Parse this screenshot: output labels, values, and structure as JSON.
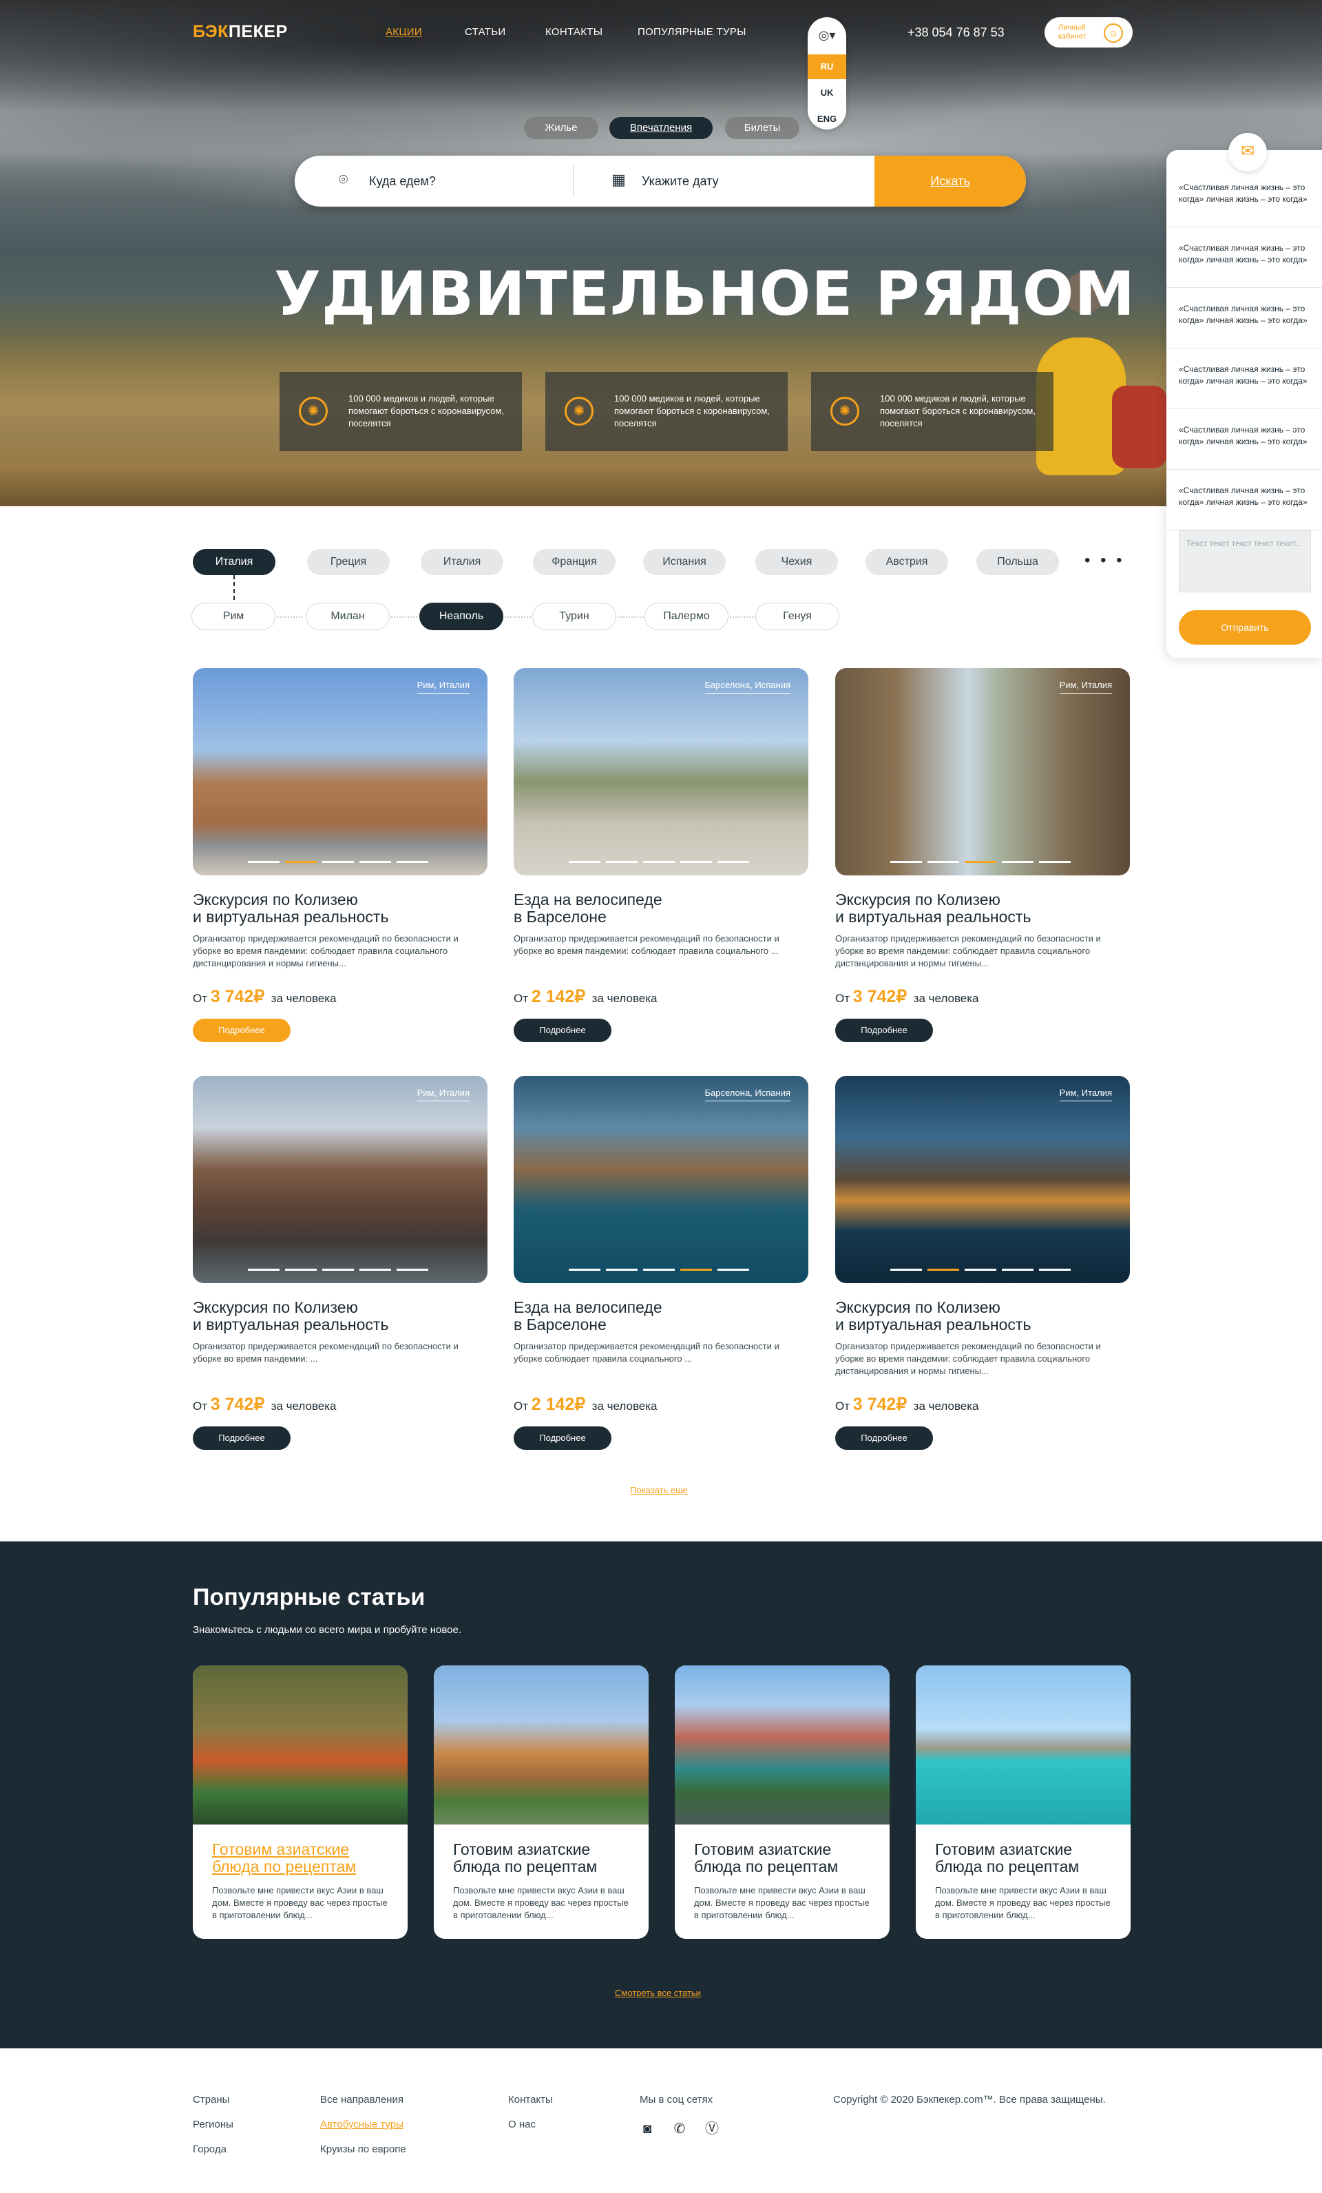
{
  "header": {
    "logo": "БЭКПЕКЕР",
    "nav": [
      "АКЦИИ",
      "СТАТЬИ",
      "КОНТАКТЫ",
      "ПОПУЛЯРНЫЕ ТУРЫ"
    ],
    "languages": [
      "RU",
      "UK",
      "ENG"
    ],
    "selected_language": "RU",
    "phone": "+38 054 76 87 53",
    "cabinet": "Личный кабинет"
  },
  "tabs": [
    "Жилье",
    "Впечатления",
    "Билеты"
  ],
  "search": {
    "where_placeholder": "Куда едем?",
    "date_placeholder": "Укажите дату",
    "button": "Искать"
  },
  "hero": {
    "title": "УДИВИТЕЛЬНОЕ РЯДОМ",
    "features": [
      "100 000 медиков и людей, которые помогают бороться с коронавирусом, поселятся",
      "100 000 медиков и людей, которые помогают бороться с коронавирусом, поселятся",
      "100 000 медиков и людей, которые помогают бороться с коронавирусом, поселятся"
    ]
  },
  "chat": {
    "messages": [
      "«Счастливая личная жизнь – это когда» личная жизнь – это когда»",
      "«Счастливая личная жизнь – это когда» личная жизнь – это когда»",
      "«Счастливая личная жизнь – это когда» личная жизнь – это когда»",
      "«Счастливая личная жизнь – это когда» личная жизнь – это когда»",
      "«Счастливая личная жизнь – это когда» личная жизнь – это когда»",
      "«Счастливая личная жизнь – это когда» личная жизнь – это когда»"
    ],
    "textarea_placeholder": "Текст текст текст текст текст...",
    "send": "Отправить"
  },
  "countries": [
    "Италия",
    "Греция",
    "Италия",
    "Франция",
    "Испания",
    "Чехия",
    "Австрия",
    "Польша"
  ],
  "countries_more": "• • •",
  "cities": [
    "Рим",
    "Милан",
    "Неаполь",
    "Турин",
    "Палермо",
    "Генуя"
  ],
  "tours": [
    {
      "loc": "Рим, Италия",
      "title": "Экскурсия по Колизею\nи виртуальная реальность",
      "desc": "Организатор придерживается рекомендаций по безопасности и уборке во время пандемии: соблюдает правила социального дистанцирования и нормы гигиены...",
      "from": "От",
      "price": "3 742₽",
      "per": "за человека",
      "button": "Подробнее"
    },
    {
      "loc": "Барселона, Испания",
      "title": "Езда на велосипеде\nв Барселоне",
      "desc": "Организатор придерживается рекомендаций по безопасности и уборке во время пандемии: соблюдает правила социального ...",
      "from": "От",
      "price": "2 142₽",
      "per": "за человека",
      "button": "Подробнее"
    },
    {
      "loc": "Рим, Италия",
      "title": "Экскурсия по Колизею\nи виртуальная реальность",
      "desc": "Организатор придерживается рекомендаций по безопасности и уборке во время пандемии: соблюдает правила социального дистанцирования и нормы гигиены...",
      "from": "От",
      "price": "3 742₽",
      "per": "за человека",
      "button": "Подробнее"
    },
    {
      "loc": "Рим, Италия",
      "title": "Экскурсия по Колизею\nи виртуальная реальность",
      "desc": "Организатор придерживается рекомендаций по безопасности и уборке во время пандемии: ...",
      "from": "От",
      "price": "3 742₽",
      "per": "за человека",
      "button": "Подробнее"
    },
    {
      "loc": "Барселона, Испания",
      "title": "Езда на велосипеде\nв Барселоне",
      "desc": "Организатор придерживается рекомендаций по безопасности и уборке соблюдает правила социального ...",
      "from": "От",
      "price": "2 142₽",
      "per": "за человека",
      "button": "Подробнее"
    },
    {
      "loc": "Рим, Италия",
      "title": "Экскурсия по Колизею\nи виртуальная реальность",
      "desc": "Организатор придерживается рекомендаций по безопасности и уборке во время пандемии: соблюдает правила социального дистанцирования и нормы гигиены...",
      "from": "От",
      "price": "3 742₽",
      "per": "за человека",
      "button": "Подробнее"
    }
  ],
  "show_more": "Показать еще",
  "articles": {
    "heading": "Популярные статьи",
    "sub": "Знакомьтесь с людьми со всего мира и пробуйте новое.",
    "items": [
      {
        "title": "Готовим азиатские\nблюда по рецептам",
        "desc": "Позвольте мне привести вкус Азии в ваш дом. Вместе я проведу вас через простые в приготовлении блюд..."
      },
      {
        "title": "Готовим азиатские\nблюда по рецептам",
        "desc": "Позвольте мне привести вкус Азии в ваш дом. Вместе я проведу вас через простые в приготовлении блюд..."
      },
      {
        "title": "Готовим азиатские\nблюда по рецептам",
        "desc": "Позвольте мне привести вкус Азии в ваш дом. Вместе я проведу вас через простые в приготовлении блюд..."
      },
      {
        "title": "Готовим азиатские\nблюда по рецептам",
        "desc": "Позвольте мне привести вкус Азии в ваш дом. Вместе я проведу вас через простые в приготовлении блюд..."
      }
    ],
    "all": "Смотреть все статьи"
  },
  "footer": {
    "col1": [
      "Страны",
      "Регионы",
      "Города"
    ],
    "col2": [
      "Все направления",
      "Автобусные туры",
      "Круизы по европе"
    ],
    "col3": [
      "Контакты",
      "О нас"
    ],
    "social_heading": "Мы в соц сетях",
    "copyright": "Copyright © 2020 Бэкпекер.com™. Все права защищены."
  },
  "colors": {
    "accent": "#f7a21b",
    "dark": "#1c2a33"
  }
}
